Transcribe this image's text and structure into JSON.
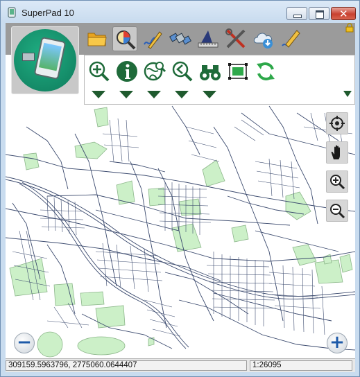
{
  "window": {
    "title": "SuperPad 10"
  },
  "toolbar": {
    "tools": [
      {
        "name": "folder-icon",
        "active": false
      },
      {
        "name": "map-query-icon",
        "active": true
      },
      {
        "name": "draw-edit-icon",
        "active": false
      },
      {
        "name": "gps-satellite-icon",
        "active": false
      },
      {
        "name": "survey-measure-icon",
        "active": false
      },
      {
        "name": "tools-settings-icon",
        "active": false
      },
      {
        "name": "cloud-download-icon",
        "active": false
      },
      {
        "name": "pencil-sketch-icon",
        "active": false
      }
    ]
  },
  "subtoolbar": {
    "tools": [
      "zoom-in-icon",
      "info-icon",
      "globe-search-icon",
      "zoom-back-icon",
      "binoculars-icon",
      "select-rectangle-icon",
      "refresh-icon"
    ]
  },
  "map_controls": [
    "locate-icon",
    "pan-hand-icon",
    "zoom-in-icon",
    "zoom-out-icon"
  ],
  "zoom_buttons": {
    "minus": "−",
    "plus": "+"
  },
  "status": {
    "coordinates": "309159.5963796, 2775060.0644407",
    "scale": "1:26095"
  },
  "colors": {
    "park_fill": "#ccf0c8",
    "road": "#3b4a6e",
    "accent_green": "#1f5a2e"
  }
}
